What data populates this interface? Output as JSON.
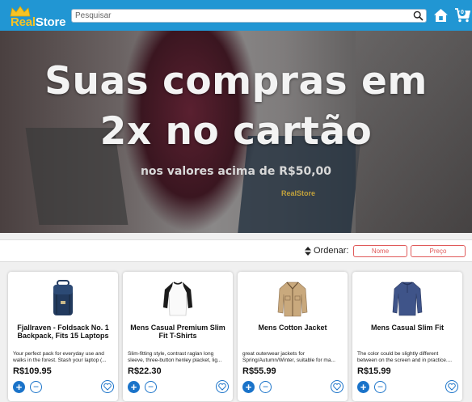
{
  "brand": {
    "name_part1": "Real",
    "name_part2": "Store"
  },
  "search": {
    "placeholder": "Pesquisar",
    "value": ""
  },
  "cart": {
    "count": "0"
  },
  "banner": {
    "headline_line1": "Suas compras em",
    "headline_line2": "2x no cartão",
    "subtitle": "nos valores acima de R$50,00",
    "logo_text": "RealStore"
  },
  "sort": {
    "label": "Ordenar:",
    "options": [
      "Nome",
      "Preço"
    ]
  },
  "products": [
    {
      "title": "Fjallraven - Foldsack No. 1 Backpack, Fits 15 Laptops",
      "description": "Your perfect pack for everyday use and walks in the forest. Stash your laptop (...",
      "price": "R$109.95",
      "icon": "backpack-icon"
    },
    {
      "title": "Mens Casual Premium Slim Fit T-Shirts",
      "description": "Slim-fitting style, contrast raglan long sleeve, three-button henley placket, lig...",
      "price": "R$22.30",
      "icon": "raglan-tshirt-icon"
    },
    {
      "title": "Mens Cotton Jacket",
      "description": "great outerwear jackets for Spring/Autumn/Winter, suitable for ma...",
      "price": "R$55.99",
      "icon": "jacket-icon"
    },
    {
      "title": "Mens Casual Slim Fit",
      "description": "The color could be slightly different between on the screen and in practice....",
      "price": "R$15.99",
      "icon": "longsleeve-shirt-icon"
    }
  ],
  "colors": {
    "header": "#2196d3",
    "accent": "#1a73c9",
    "sort_border": "#e05a5a",
    "logo_gold": "#f6c325"
  }
}
